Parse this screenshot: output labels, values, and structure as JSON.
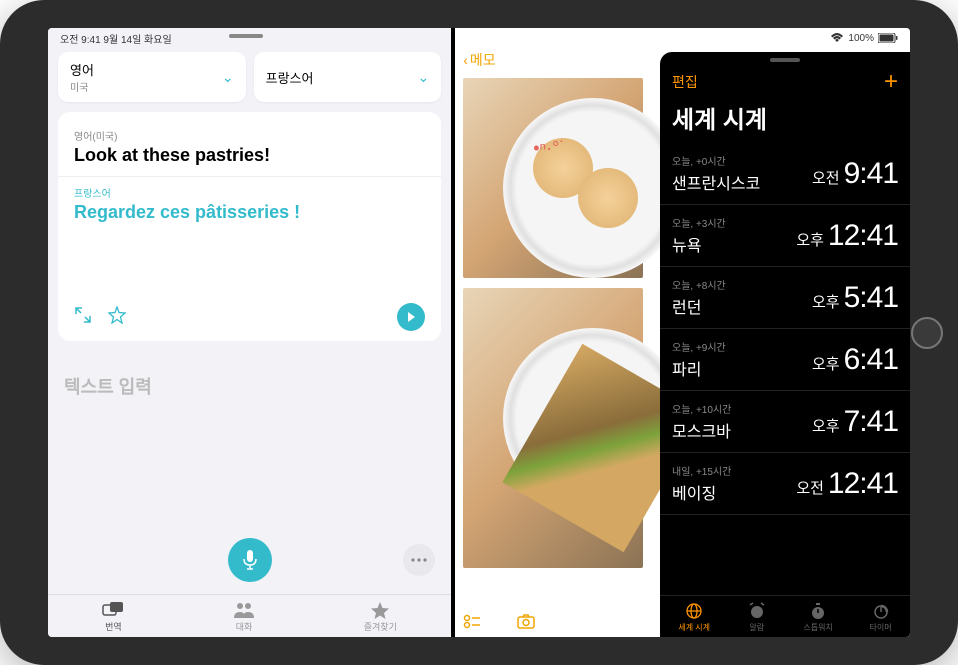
{
  "status": {
    "time_text": "오전 9:41  9월 14일 화요일",
    "wifi": "wifi-icon",
    "battery_pct": "100%"
  },
  "translate": {
    "source_lang": "영어",
    "source_region": "미국",
    "target_lang": "프랑스어",
    "source_label": "영어(미국)",
    "source_text": "Look at these pastries!",
    "target_label": "프랑스어",
    "target_text": "Regardez ces pâtisseries !",
    "input_placeholder": "텍스트 입력",
    "tabs": [
      {
        "label": "번역"
      },
      {
        "label": "대화"
      },
      {
        "label": "즐겨찾기"
      }
    ]
  },
  "notes": {
    "back_label": "메모"
  },
  "clock": {
    "edit_label": "편집",
    "title": "세계 시계",
    "rows": [
      {
        "offset": "오늘, +0시간",
        "city": "샌프란시스코",
        "ampm": "오전",
        "time": "9:41"
      },
      {
        "offset": "오늘, +3시간",
        "city": "뉴욕",
        "ampm": "오후",
        "time": "12:41"
      },
      {
        "offset": "오늘, +8시간",
        "city": "런던",
        "ampm": "오후",
        "time": "5:41"
      },
      {
        "offset": "오늘, +9시간",
        "city": "파리",
        "ampm": "오후",
        "time": "6:41"
      },
      {
        "offset": "오늘, +10시간",
        "city": "모스크바",
        "ampm": "오후",
        "time": "7:41"
      },
      {
        "offset": "내일, +15시간",
        "city": "베이징",
        "ampm": "오전",
        "time": "12:41"
      }
    ],
    "tabs": [
      {
        "label": "세계 시계"
      },
      {
        "label": "알람"
      },
      {
        "label": "스톱워치"
      },
      {
        "label": "타이머"
      }
    ]
  }
}
